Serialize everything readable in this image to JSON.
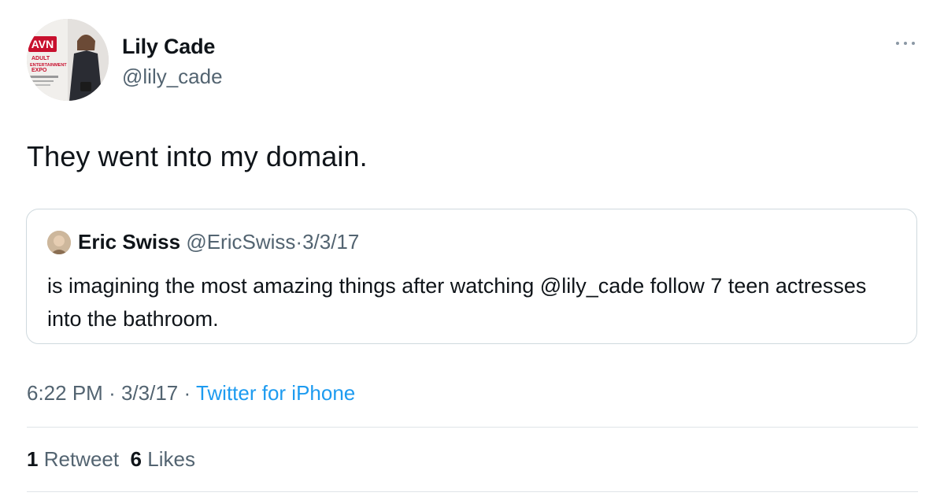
{
  "author": {
    "name": "Lily Cade",
    "handle": "@lily_cade",
    "avatar_backdrop_text": "AVN ADULT ENTERTAINMENT EXPO"
  },
  "tweet": {
    "text": "They went into my domain."
  },
  "quoted_tweet": {
    "name": "Eric Swiss",
    "handle": "@EricSwiss",
    "separator": "·",
    "date": "3/3/17",
    "text": "is imagining the most amazing things after watching @lily_cade follow 7 teen actresses into the bathroom."
  },
  "meta": {
    "time": "6:22 PM",
    "separator": "·",
    "date": "3/3/17",
    "source": "Twitter for iPhone"
  },
  "stats": {
    "retweets_count": "1",
    "retweets_label": "Retweet",
    "likes_count": "6",
    "likes_label": "Likes"
  },
  "icons": {
    "more": "more-horizontal-icon"
  },
  "colors": {
    "link": "#1d9bf0",
    "secondary_text": "#536471",
    "border": "#cfd9de"
  }
}
